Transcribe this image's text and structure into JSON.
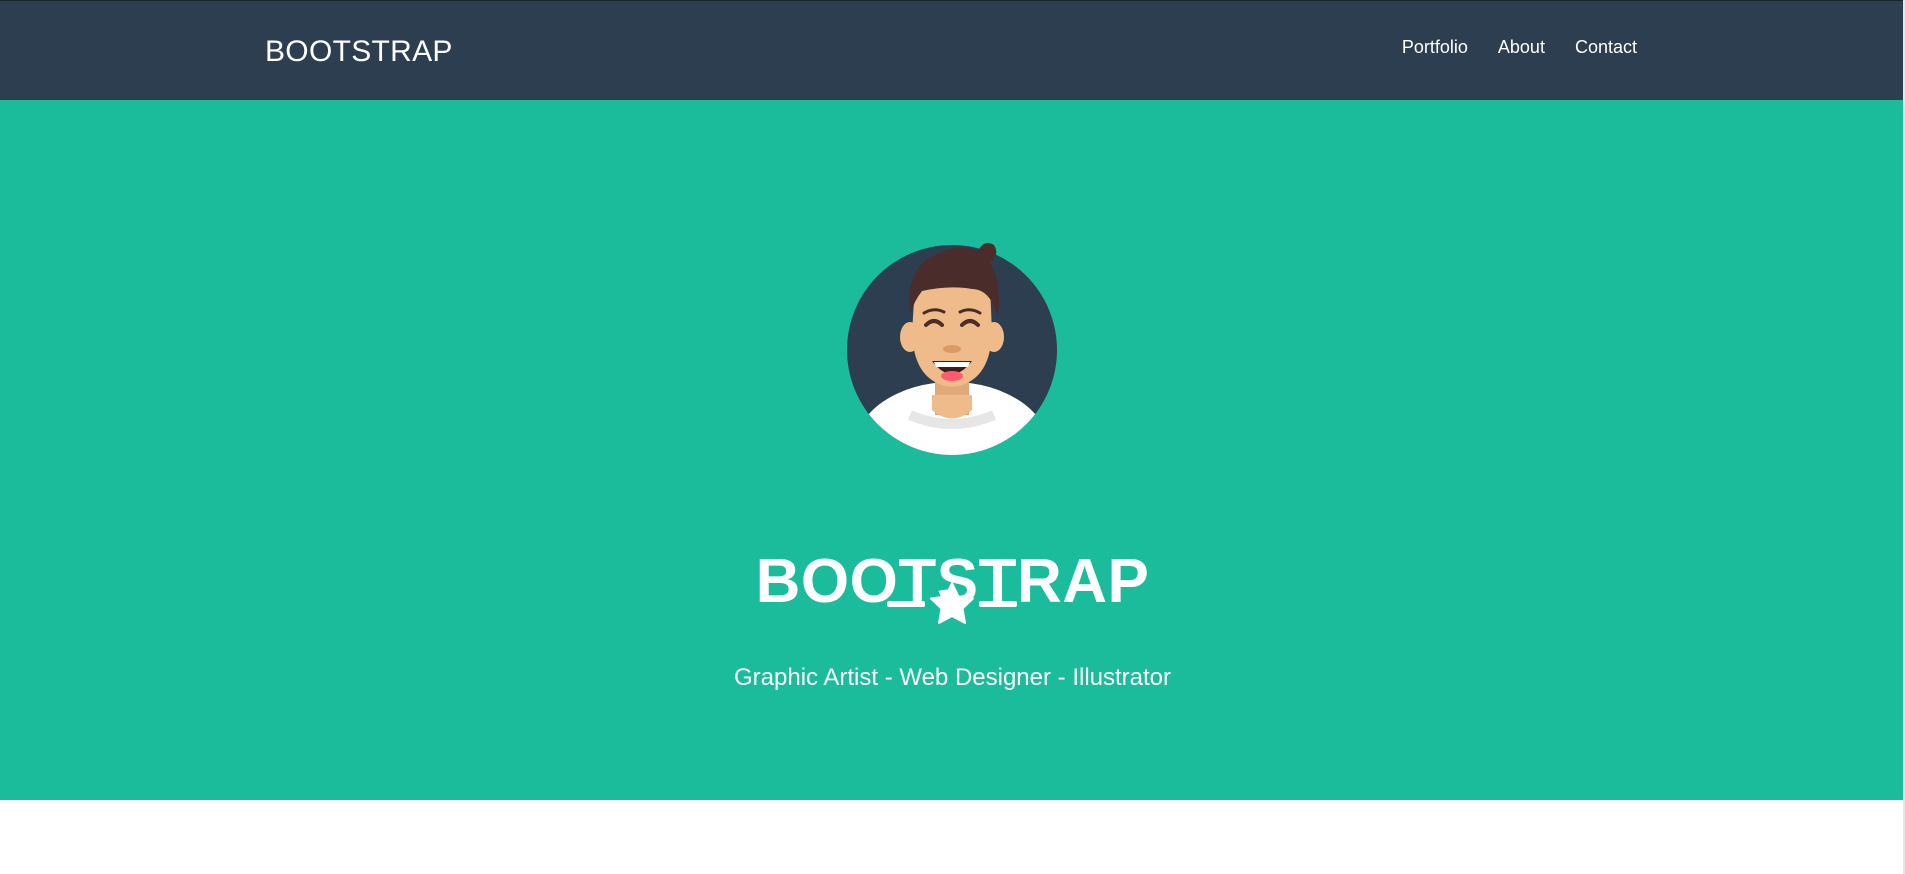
{
  "navbar": {
    "brand": "BOOTSTRAP",
    "links": [
      {
        "label": "Portfolio"
      },
      {
        "label": "About"
      },
      {
        "label": "Contact"
      }
    ]
  },
  "hero": {
    "title": "BOOTSTRAP",
    "tagline": "Graphic Artist - Web Designer - Illustrator",
    "avatar_icon": "avatar-illustration",
    "divider_icon": "star-icon"
  },
  "colors": {
    "navbar_bg": "#2c3e50",
    "hero_bg": "#1abc9c",
    "text": "#ffffff"
  }
}
